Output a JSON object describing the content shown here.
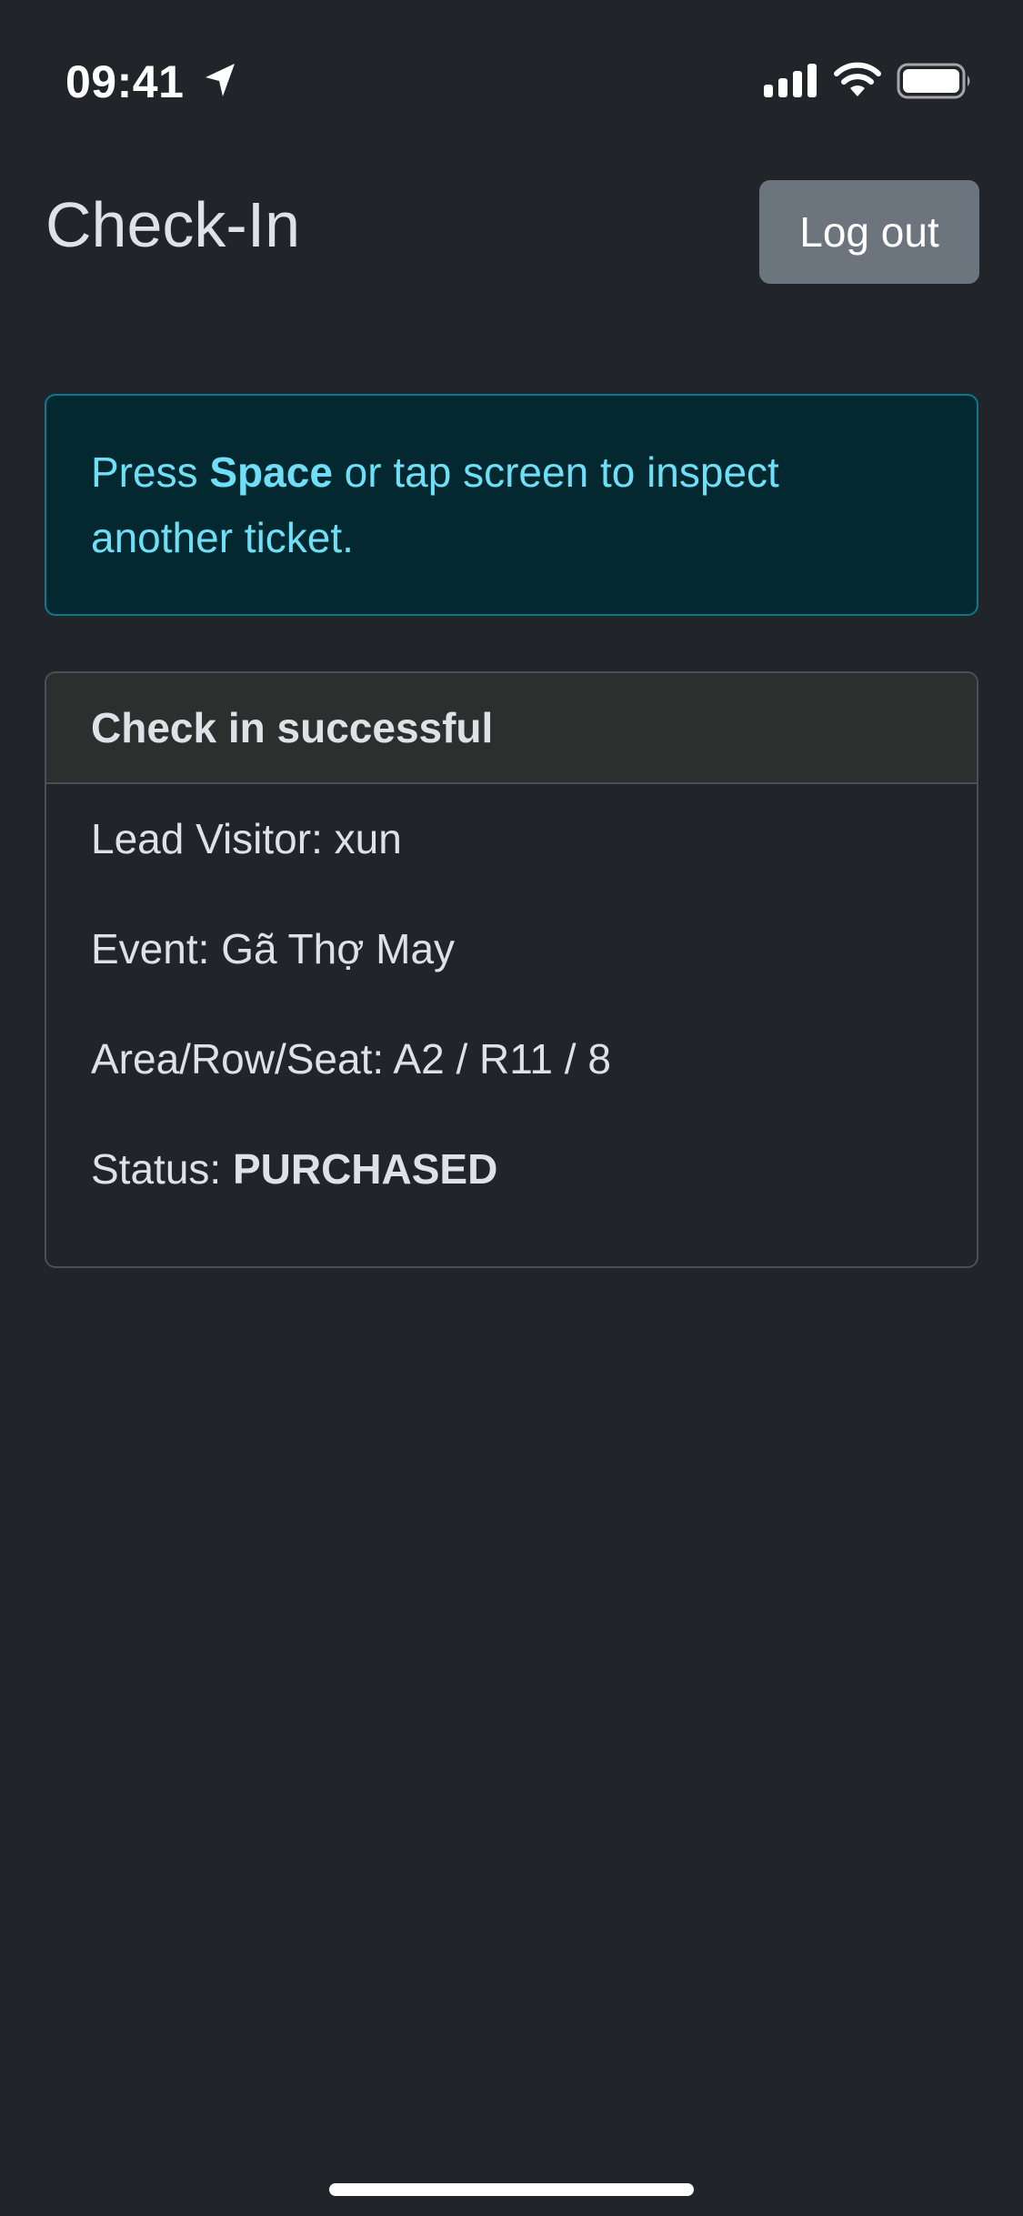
{
  "status_bar": {
    "time": "09:41",
    "icons": [
      "location-arrow-icon",
      "cellular-signal-icon",
      "wifi-icon",
      "battery-icon"
    ]
  },
  "header": {
    "title": "Check-In",
    "logout_label": "Log out"
  },
  "alert": {
    "prefix": "Press ",
    "key": "Space",
    "suffix": " or tap screen to inspect another ticket."
  },
  "card": {
    "title": "Check in successful",
    "lead_visitor_label": "Lead Visitor: ",
    "lead_visitor_value": "xun",
    "event_label": "Event: ",
    "event_value": "Gã Thợ May",
    "seat_label": "Area/Row/Seat: ",
    "seat_value": "A2 / R11 / 8",
    "status_label": "Status: ",
    "status_value": "PURCHASED"
  },
  "colors": {
    "background": "#212529",
    "alert_background": "#032830",
    "alert_border": "#087990",
    "alert_text": "#6edff6",
    "button_background": "#6c757d",
    "card_header_background": "#2b2f2d",
    "card_border": "#495057",
    "text": "#dee2e6"
  }
}
